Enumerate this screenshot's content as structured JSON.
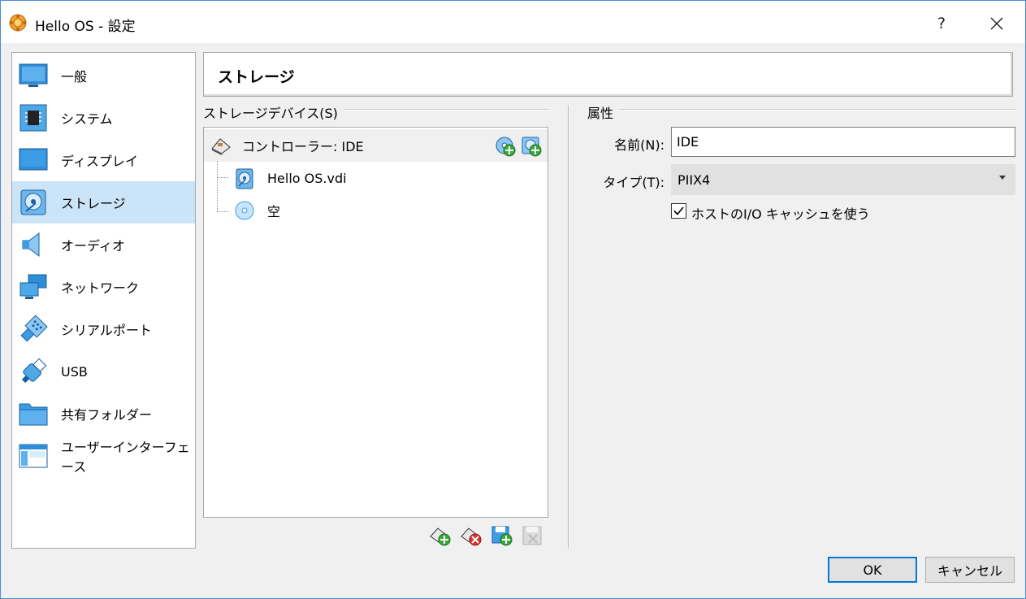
{
  "window": {
    "title": "Hello OS - 設定",
    "help_label": "?"
  },
  "sidebar": {
    "items": [
      {
        "label": "一般",
        "icon": "monitor-icon"
      },
      {
        "label": "システム",
        "icon": "chip-icon"
      },
      {
        "label": "ディスプレイ",
        "icon": "display-icon"
      },
      {
        "label": "ストレージ",
        "icon": "storage-icon",
        "selected": true
      },
      {
        "label": "オーディオ",
        "icon": "speaker-icon"
      },
      {
        "label": "ネットワーク",
        "icon": "network-icon"
      },
      {
        "label": "シリアルポート",
        "icon": "serial-port-icon"
      },
      {
        "label": "USB",
        "icon": "usb-icon"
      },
      {
        "label": "共有フォルダー",
        "icon": "folder-icon"
      },
      {
        "label": "ユーザーインターフェース",
        "icon": "ui-window-icon"
      }
    ]
  },
  "page": {
    "title": "ストレージ"
  },
  "storage": {
    "group_title": "ストレージデバイス(S)",
    "controller_label": "コントローラー: IDE",
    "devices": [
      {
        "label": "Hello OS.vdi",
        "icon": "hard-disk-icon"
      },
      {
        "label": "空",
        "icon": "optical-disc-icon"
      }
    ]
  },
  "attributes": {
    "group_title": "属性",
    "name_label": "名前(N):",
    "name_value": "IDE",
    "type_label": "タイプ(T):",
    "type_value": "PIIX4",
    "cache_label": "ホストのI/O キャッシュを使う",
    "cache_checked": true
  },
  "buttons": {
    "ok": "OK",
    "cancel": "キャンセル"
  },
  "colors": {
    "selection": "#cce4f7",
    "accent": "#0078d7",
    "icon_blue": "#2f8ed8"
  }
}
